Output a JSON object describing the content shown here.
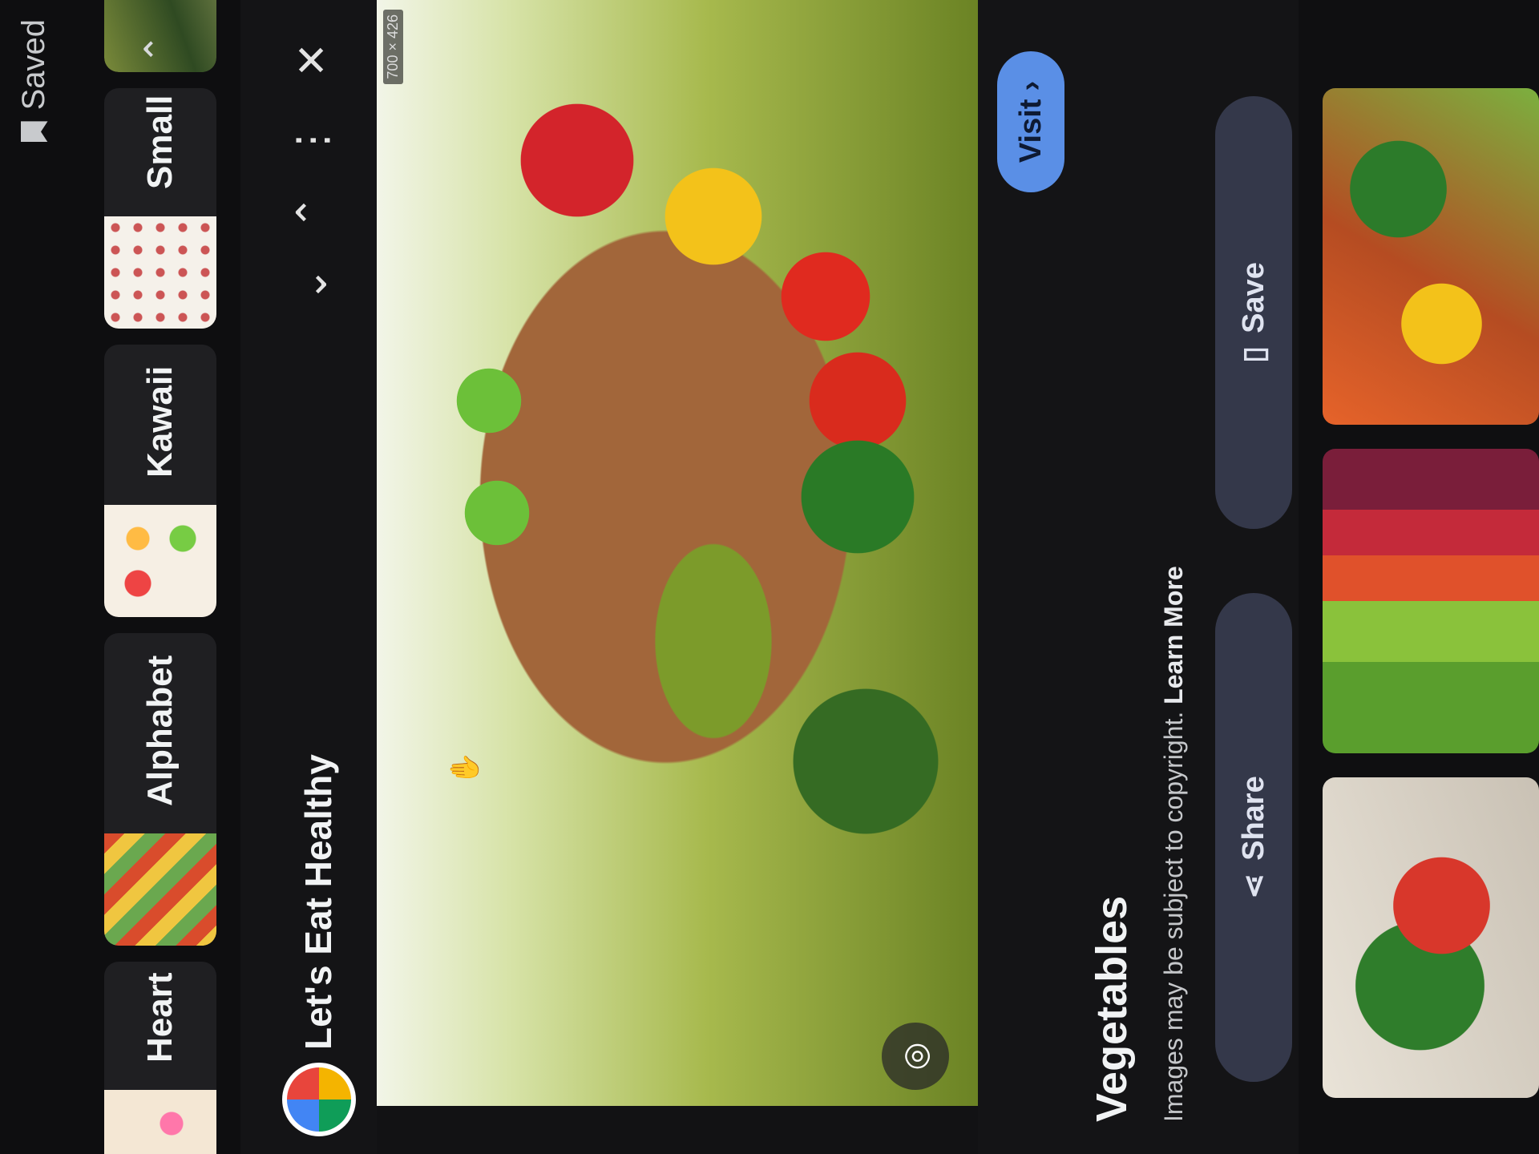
{
  "top_bar": {
    "saved_label": "Saved"
  },
  "chips": [
    {
      "label": "Heart",
      "thumb": "hearts-pattern"
    },
    {
      "label": "Alphabet",
      "thumb": "vegetable-alphabet"
    },
    {
      "label": "Kawaii",
      "thumb": "kawaii-fruits"
    },
    {
      "label": "Small",
      "thumb": "small-fruit-icons"
    },
    {
      "label": "",
      "thumb": "garden-photo"
    }
  ],
  "header": {
    "title": "Let's Eat Healthy",
    "down_glyph": "⌄",
    "up_glyph": "⌃",
    "more_glyph": "⋮",
    "close_glyph": "✕",
    "chevron_up_glyph": "⌃"
  },
  "image": {
    "dimensions": "700 × 426",
    "alt": "Vegetables basket"
  },
  "info": {
    "visit_label": "Visit",
    "visit_arrow": "›",
    "title": "Vegetables",
    "copyright_note": "Images may be subject to copyright.",
    "learn_more": "Learn More",
    "share_label": "Share",
    "save_label": "Save"
  },
  "colors": {
    "background": "#121214",
    "accent_button": "#5a8fe6",
    "pill": "#34384a",
    "text": "#e8eaed"
  }
}
